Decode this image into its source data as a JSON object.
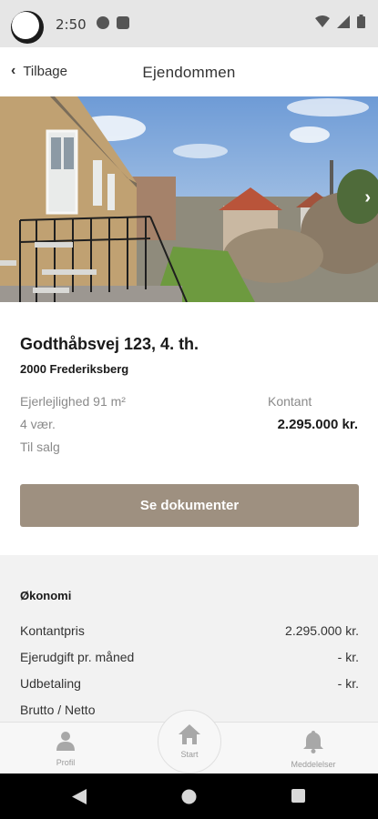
{
  "status_bar": {
    "time": "2:50"
  },
  "header": {
    "back_label": "Tilbage",
    "title": "Ejendommen"
  },
  "property": {
    "address": "Godthåbsvej 123, 4. th.",
    "postal": "2000 Frederiksberg",
    "type_size": "Ejerlejlighed  91 m²",
    "rooms": "4 vær.",
    "status": "Til salg",
    "price_label": "Kontant",
    "price_value": "2.295.000 kr."
  },
  "documents_button": "Se dokumenter",
  "economy": {
    "title": "Økonomi",
    "rows": [
      {
        "label": "Kontantpris",
        "value": "2.295.000 kr."
      },
      {
        "label": "Ejerudgift pr. måned",
        "value": "- kr."
      },
      {
        "label": "Udbetaling",
        "value": "- kr."
      },
      {
        "label": "Brutto / Netto",
        "value": ""
      }
    ]
  },
  "bottom_nav": {
    "profile": "Profil",
    "start": "Start",
    "messages": "Meddelelser"
  },
  "colors": {
    "accent": "#9e9080",
    "status_bar": "#e6e6e6",
    "section_bg": "#f2f2f2"
  }
}
